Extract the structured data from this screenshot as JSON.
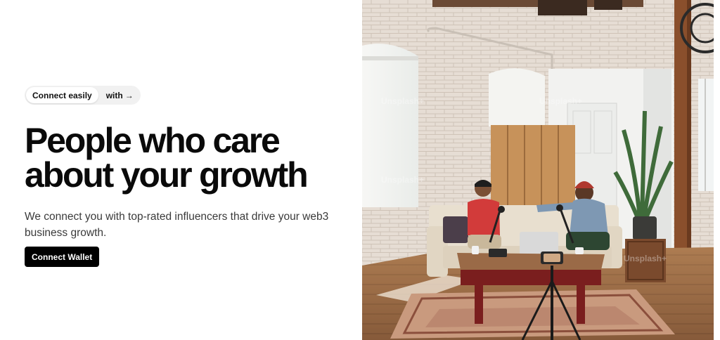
{
  "hero": {
    "pill": {
      "tag": "Connect easily",
      "link": "with",
      "arrow": "→"
    },
    "headline": {
      "line1": "People who care",
      "line2": "about your growth"
    },
    "subtitle": "We connect you with top-rated influencers that drive your web3 business growth.",
    "cta_label": "Connect Wallet"
  },
  "photo": {
    "watermark": "Unsplash+",
    "alt": "Two people recording a podcast in a loft studio"
  },
  "colors": {
    "cta_bg": "#000000",
    "text": "#0a0a0a",
    "body_text": "#3a3a3a"
  }
}
